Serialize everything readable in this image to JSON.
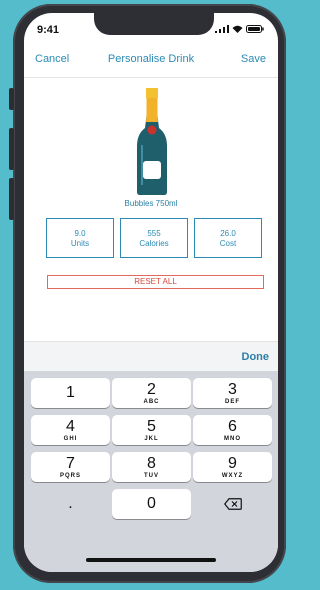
{
  "status": {
    "time": "9:41"
  },
  "nav": {
    "cancel": "Cancel",
    "title": "Personalise Drink",
    "save": "Save"
  },
  "drink": {
    "name": "Bubbles 750ml"
  },
  "stats": [
    {
      "value": "9.0",
      "label": "Units"
    },
    {
      "value": "555",
      "label": "Calories"
    },
    {
      "value": "26.0",
      "label": "Cost"
    }
  ],
  "reset_label": "RESET ALL",
  "keyboard": {
    "done": "Done",
    "keys": [
      {
        "digit": "1",
        "letters": ""
      },
      {
        "digit": "2",
        "letters": "ABC"
      },
      {
        "digit": "3",
        "letters": "DEF"
      },
      {
        "digit": "4",
        "letters": "GHI"
      },
      {
        "digit": "5",
        "letters": "JKL"
      },
      {
        "digit": "6",
        "letters": "MNO"
      },
      {
        "digit": "7",
        "letters": "PQRS"
      },
      {
        "digit": "8",
        "letters": "TUV"
      },
      {
        "digit": "9",
        "letters": "WXYZ"
      },
      {
        "digit": "0",
        "letters": ""
      }
    ],
    "decimal": ".",
    "backspace_icon": "backspace-icon"
  },
  "colors": {
    "accent": "#2b8bb4",
    "reset": "#d8483b",
    "bottle": "#1f5f6b",
    "foil": "#f2c230",
    "background": "#55bccb"
  }
}
